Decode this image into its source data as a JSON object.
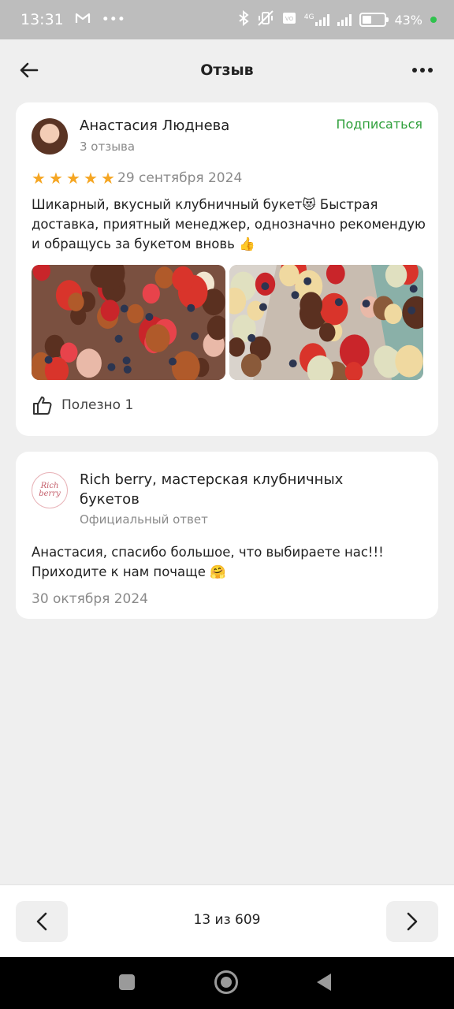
{
  "status_bar": {
    "time": "13:31",
    "battery_text": "43%",
    "battery_level": 0.43,
    "network_label": "4G",
    "icons": [
      "gmail-icon",
      "more-notifications-icon",
      "bluetooth-icon",
      "vibrate-off-icon",
      "volte-icon",
      "signal-icon",
      "battery-icon"
    ]
  },
  "header": {
    "title": "Отзыв",
    "back_icon": "arrow-left-icon",
    "menu_icon": "more-horizontal-icon"
  },
  "review": {
    "author_name": "Анастасия Люднева",
    "author_reviews": "3 отзыва",
    "subscribe_label": "Подписаться",
    "rating": 5,
    "rating_max": 5,
    "date": "29 сентября 2024",
    "text": "Шикарный, вкусный клубничный букет😻 Быстрая доставка, приятный менеджер, однозначно рекомендую и обращусь за букетом вновь 👍",
    "photos": [
      "strawberry-bouquet-photo-1",
      "strawberry-bouquet-photo-2"
    ],
    "useful_label": "Полезно 1",
    "useful_icon": "thumbs-up-icon"
  },
  "reply": {
    "shop_name": "Rich berry, мастерская клубничных букетов",
    "logo_text": "Rich berry",
    "reply_type": "Официальный ответ",
    "text": "Анастасия, спасибо большое, что выбираете нас!!! Приходите к нам почаще 🤗",
    "date": "30 октября 2024"
  },
  "pager": {
    "counter": "13 из 609",
    "prev_icon": "chevron-left-icon",
    "next_icon": "chevron-right-icon"
  },
  "colors": {
    "accent_green": "#2e9f3a",
    "star": "#f5a623",
    "background": "#efefef",
    "card": "#ffffff"
  }
}
